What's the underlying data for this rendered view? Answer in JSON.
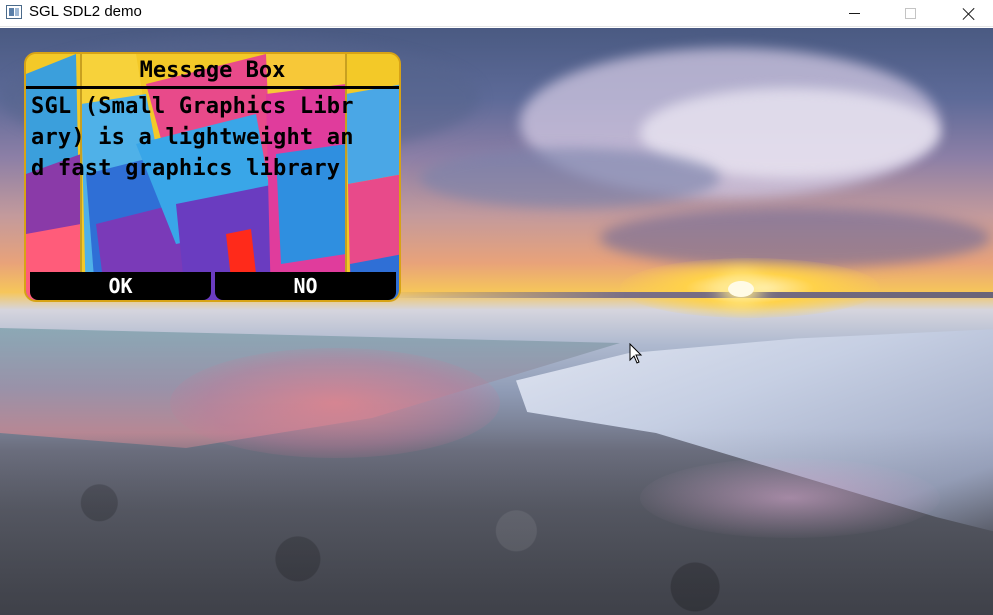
{
  "window": {
    "title": "SGL SDL2 demo",
    "icon": "app-window-icon",
    "controls": [
      "minimize-icon",
      "maximize-icon",
      "close-icon"
    ]
  },
  "message_box": {
    "title": "Message Box",
    "body_lines": [
      "SGL (Small Graphics Libr",
      "ary) is a lightweight an",
      "d fast graphics library"
    ],
    "ok_label": "OK",
    "no_label": "NO",
    "colors": {
      "frame": "#f3c928",
      "text": "#000000",
      "button_bg": "#000000",
      "button_text": "#ffffff"
    }
  },
  "cursor": {
    "icon": "mouse-pointer-icon"
  }
}
